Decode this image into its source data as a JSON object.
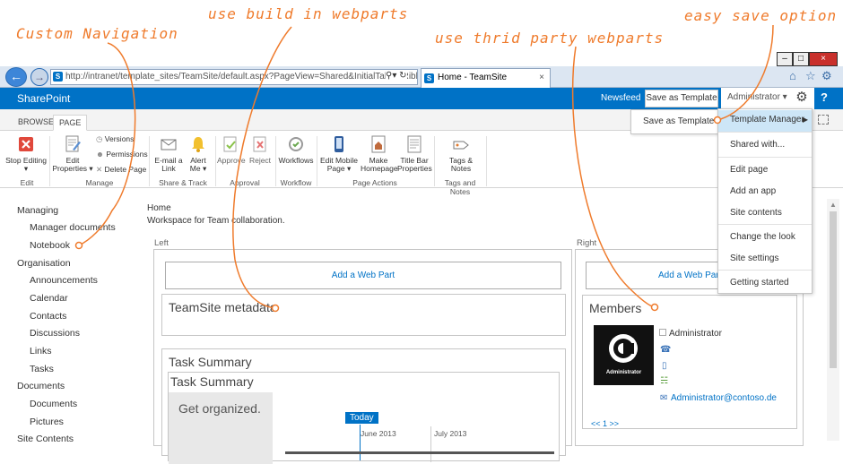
{
  "annotations": {
    "custom_nav": "Custom Navigation",
    "build_in": "use build in webparts",
    "third_party": "use thrid party webparts",
    "easy_save": "easy save option"
  },
  "browser": {
    "url": "http://intranet/template_sites/TeamSite/default.aspx?PageView=Shared&InitialTabId=Ribbor",
    "url_host": "intranet",
    "tab_title": "Home - TeamSite",
    "min": "–",
    "max": "□",
    "close": "×"
  },
  "suitebar": {
    "brand": "SharePoint",
    "newsfeed": "Newsfeed",
    "save_template": "Save as Template",
    "user": "Administrator ▾",
    "settings": "⚙",
    "help": "?"
  },
  "ribbon": {
    "tabs": [
      "BROWSE",
      "PAGE"
    ],
    "buttons": {
      "stop_editing": [
        "Stop Editing",
        "▾"
      ],
      "edit_properties": [
        "Edit",
        "Properties ▾"
      ],
      "versions": "Versions",
      "permissions": "Permissions",
      "delete_page": "Delete Page",
      "email_link": [
        "E-mail a",
        "Link"
      ],
      "alert_me": [
        "Alert",
        "Me ▾"
      ],
      "approve": "Approve",
      "reject": "Reject",
      "workflows": "Workflows",
      "edit_mobile": [
        "Edit Mobile",
        "Page ▾"
      ],
      "make_homepage": [
        "Make",
        "Homepage"
      ],
      "title_bar": [
        "Title Bar",
        "Properties"
      ],
      "tags_notes": [
        "Tags &",
        "Notes"
      ]
    },
    "groups": [
      "Edit",
      "Manage",
      "Share & Track",
      "Approval",
      "Workflow",
      "Page Actions",
      "Tags and Notes"
    ]
  },
  "nav": {
    "sections": [
      {
        "title": "Managing",
        "items": [
          "Manager documents",
          "Notebook"
        ]
      },
      {
        "title": "Organisation",
        "items": [
          "Announcements",
          "Calendar",
          "Contacts",
          "Discussions",
          "Links",
          "Tasks"
        ]
      },
      {
        "title": "Documents",
        "items": [
          "Documents",
          "Pictures"
        ]
      },
      {
        "title": "Site Contents",
        "items": []
      }
    ]
  },
  "page": {
    "breadcrumb": "Home",
    "description": "Workspace for Team collaboration.",
    "left_label": "Left",
    "right_label": "Right",
    "add_webpart": "Add a Web Part",
    "teamsite_metadata": "TeamSite metadata",
    "task_summary": "Task Summary",
    "task_summary_inner": "Task Summary",
    "get_organized": "Get organized.",
    "today": "Today",
    "june": "June 2013",
    "july": "July 2013",
    "members": "Members",
    "member_name": "Administrator",
    "member_email": "Administrator@contoso.de",
    "pager": "<< 1 >>",
    "avatar_label": "Administrator"
  },
  "settings_menu": {
    "flyout": "Save as Template",
    "template_manager": "Template Manager",
    "items": [
      "Shared with...",
      "Edit page",
      "Add an app",
      "Site contents",
      "Change the look",
      "Site settings",
      "Getting started"
    ]
  },
  "colors": {
    "accent": "#0072c6",
    "annotation": "#ef7b2c"
  }
}
